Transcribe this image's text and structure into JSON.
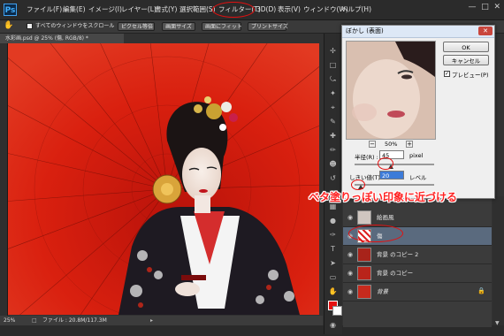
{
  "app": {
    "logo": "Ps",
    "menus": [
      "ファイル(F)",
      "編集(E)",
      "イメージ(I)",
      "レイヤー(L)",
      "書式(Y)",
      "選択範囲(S)",
      "フィルター(T)",
      "3D(D)",
      "表示(V)",
      "ウィンドウ(W)",
      "ヘルプ(H)"
    ]
  },
  "options_bar": {
    "checkbox_label": "すべてのウィンドウをスクロール",
    "buttons": [
      "ピクセル等倍",
      "画面サイズ",
      "画面にフィット",
      "プリントサイズ"
    ]
  },
  "document": {
    "tab_title": "水彩画.psd @ 25% (傷, RGB/8) *",
    "zoom": "25%",
    "file_info": "ファイル : 20.8M/117.3M"
  },
  "dialog": {
    "title": "ぼかし (表面)",
    "ok_label": "OK",
    "cancel_label": "キャンセル",
    "preview_label": "プレビュー(P)",
    "preview_checked": true,
    "zoom_value": "50%",
    "radius_label": "半径(R) :",
    "radius_value": "45",
    "radius_unit": "pixel",
    "radius_level": 0.45,
    "threshold_label": "しきい値(T) :",
    "threshold_value": "20",
    "threshold_unit": "レベル",
    "threshold_level": 0.08
  },
  "annotation": "ベタ塗りっぽい印象に近づける",
  "layers": [
    {
      "name": "絵画風",
      "active": false
    },
    {
      "name": "傷",
      "active": true
    },
    {
      "name": "背景 のコピー 2",
      "active": false
    },
    {
      "name": "背景 のコピー",
      "active": false
    },
    {
      "name": "背景",
      "active": false,
      "locked": true
    }
  ],
  "colors": {
    "accent_red": "#e41010",
    "umbrella_red": "#d2180f"
  }
}
